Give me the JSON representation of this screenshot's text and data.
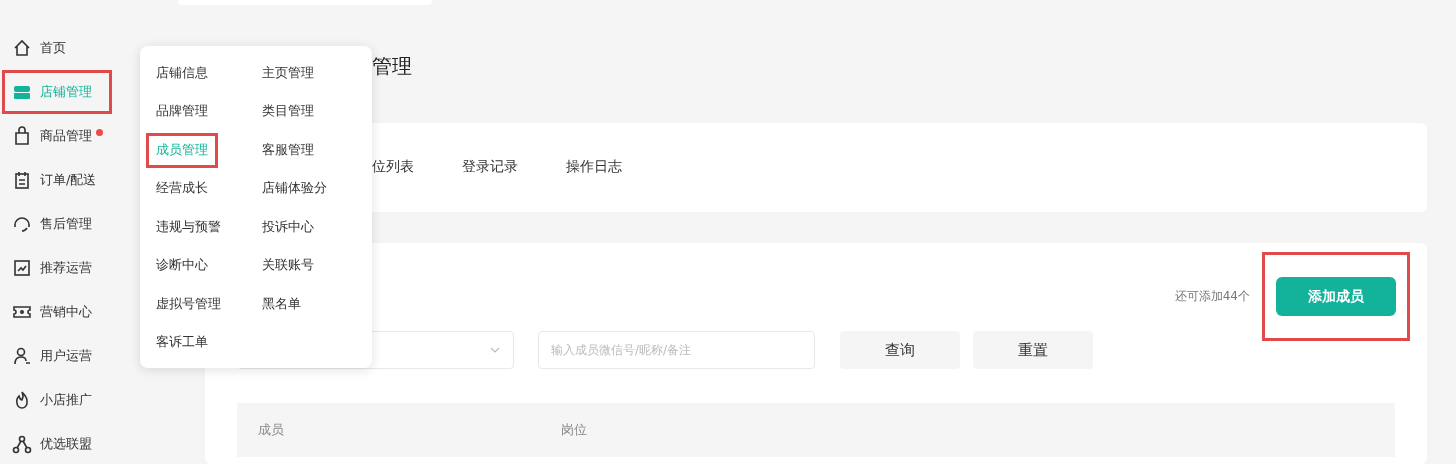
{
  "sidebar": {
    "items": [
      {
        "label": "首页",
        "selected": false,
        "highlighted": false,
        "new_dot": false
      },
      {
        "label": "店铺管理",
        "selected": true,
        "highlighted": true,
        "new_dot": false
      },
      {
        "label": "商品管理",
        "selected": false,
        "highlighted": false,
        "new_dot": true
      },
      {
        "label": "订单/配送",
        "selected": false,
        "highlighted": false,
        "new_dot": false
      },
      {
        "label": "售后管理",
        "selected": false,
        "highlighted": false,
        "new_dot": false
      },
      {
        "label": "推荐运营",
        "selected": false,
        "highlighted": false,
        "new_dot": false
      },
      {
        "label": "营销中心",
        "selected": false,
        "highlighted": false,
        "new_dot": false
      },
      {
        "label": "用户运营",
        "selected": false,
        "highlighted": false,
        "new_dot": false
      },
      {
        "label": "小店推广",
        "selected": false,
        "highlighted": false,
        "new_dot": false
      },
      {
        "label": "优选联盟",
        "selected": false,
        "highlighted": false,
        "new_dot": false
      }
    ]
  },
  "popup_menu": {
    "items": [
      {
        "label": "店铺信息",
        "selected": false,
        "highlighted": false
      },
      {
        "label": "主页管理",
        "selected": false,
        "highlighted": false
      },
      {
        "label": "品牌管理",
        "selected": false,
        "highlighted": false
      },
      {
        "label": "类目管理",
        "selected": false,
        "highlighted": false
      },
      {
        "label": "成员管理",
        "selected": true,
        "highlighted": true
      },
      {
        "label": "客服管理",
        "selected": false,
        "highlighted": false
      },
      {
        "label": "经营成长",
        "selected": false,
        "highlighted": false
      },
      {
        "label": "店铺体验分",
        "selected": false,
        "highlighted": false
      },
      {
        "label": "违规与预警",
        "selected": false,
        "highlighted": false
      },
      {
        "label": "投诉中心",
        "selected": false,
        "highlighted": false
      },
      {
        "label": "诊断中心",
        "selected": false,
        "highlighted": false
      },
      {
        "label": "关联账号",
        "selected": false,
        "highlighted": false
      },
      {
        "label": "虚拟号管理",
        "selected": false,
        "highlighted": false
      },
      {
        "label": "黑名单",
        "selected": false,
        "highlighted": false
      },
      {
        "label": "客诉工单",
        "selected": false,
        "highlighted": false
      }
    ]
  },
  "page": {
    "title": "管理"
  },
  "tabs": [
    {
      "label": "位列表",
      "selected": false
    },
    {
      "label": "登录记录",
      "selected": false
    },
    {
      "label": "操作日志",
      "selected": false
    }
  ],
  "members": {
    "quota_text": "还可添加44个",
    "add_button": {
      "label": "添加成员",
      "highlighted": true
    },
    "search": {
      "placeholder": "输入成员微信号/昵称/备注"
    },
    "buttons": [
      "查询",
      "重置"
    ],
    "table": {
      "columns": [
        "成员",
        "岗位"
      ]
    }
  }
}
